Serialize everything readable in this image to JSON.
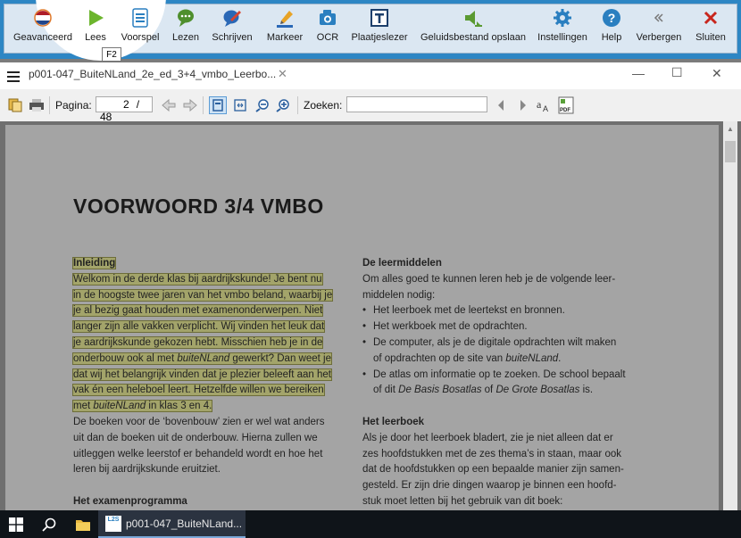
{
  "toolbar": {
    "items": [
      {
        "label": "Geavanceerd",
        "icon": "flag-icon"
      },
      {
        "label": "Lees",
        "icon": "play-icon"
      },
      {
        "label": "Voorspel",
        "icon": "predict-list-icon"
      },
      {
        "label": "Lezen",
        "icon": "speech-bubble-icon"
      },
      {
        "label": "Schrijven",
        "icon": "pen-bubble-icon"
      },
      {
        "label": "Markeer",
        "icon": "highlighter-icon"
      },
      {
        "label": "OCR",
        "icon": "camera-icon"
      },
      {
        "label": "Plaatjeslezer",
        "icon": "text-frame-icon"
      },
      {
        "label": "Geluidsbestand opslaan",
        "icon": "speaker-icon"
      },
      {
        "label": "Instellingen",
        "icon": "gear-icon"
      },
      {
        "label": "Help",
        "icon": "help-icon"
      },
      {
        "label": "Verbergen",
        "icon": "double-chevron-icon"
      },
      {
        "label": "Sluiten",
        "icon": "close-icon"
      }
    ],
    "tooltip": "F2"
  },
  "document": {
    "tab_title": "p001-047_BuiteNLand_2e_ed_3+4_vmbo_Leerbo...",
    "nav": {
      "page_label": "Pagina:",
      "page_current": "2",
      "page_total": "/ 48",
      "search_label": "Zoeken:"
    },
    "page": {
      "heading": "VOORWOORD 3/4 VMBO",
      "left": {
        "intro_heading": "Inleiding",
        "hl_lines": [
          "Welkom in de derde klas bij aardrijkskunde! Je bent nu",
          "in de hoogste twee jaren van het vmbo beland, waarbij je",
          "je al bezig gaat houden met examenonderwerpen. Niet",
          "langer zijn alle vakken verplicht. Wij vinden het leuk dat",
          "je aardrijkskunde gekozen hebt. Misschien heb je in de"
        ],
        "hl6_a": "onderbouw ook al met ",
        "hl6_it": "buiteNLand",
        "hl6_b": " gewerkt? Dan weet je",
        "hl_lines_2": [
          "dat wij het belangrijk vinden dat je plezier beleeft aan het",
          "vak én een heleboel leert. Hetzelfde willen we bereiken"
        ],
        "hl9_a": "met ",
        "hl9_it": "buiteNLand",
        "hl9_b": " in klas 3 en 4.",
        "para_lines": [
          "De boeken voor de ‘bovenbouw’ zien er wel wat anders",
          "uit dan de boeken uit de onderbouw. Hierna zullen we",
          "uitleggen welke leerstof er behandeld wordt en hoe het",
          "leren bij aardrijkskunde eruitziet."
        ],
        "exam_heading": "Het examenprogramma"
      },
      "right": {
        "h1": "De leermiddelen",
        "intro": "Om alles goed te kunnen leren heb je de volgende leer-",
        "intro2": "middelen nodig:",
        "b1": "Het leerboek met de leertekst en bronnen.",
        "b2": "Het werkboek met de opdrachten.",
        "b3a": "De computer, als je de digitale opdrachten wilt maken",
        "b3b": "of opdrachten op de site van ",
        "b3it": "buiteNLand",
        "b3c": ".",
        "b4a": "De atlas om informatie op te zoeken. De school bepaalt",
        "b4b": "of dit ",
        "b4it1": "De Basis Bosatlas",
        "b4c": " of ",
        "b4it2": "De Grote Bosatlas",
        "b4d": " is.",
        "h2": "Het leerboek",
        "lines": [
          "Als je door het leerboek bladert, zie je niet alleen dat er",
          "zes hoofdstukken met de zes thema’s in staan, maar ook",
          "dat de hoofdstukken op een bepaalde manier zijn samen-",
          "gesteld. Er zijn drie dingen waarop je binnen een hoofd-",
          "stuk moet letten bij het gebruik van dit boek:"
        ]
      }
    }
  },
  "taskbar": {
    "app_badge": "L2S",
    "app_label": "p001-047_BuiteNLand..."
  }
}
